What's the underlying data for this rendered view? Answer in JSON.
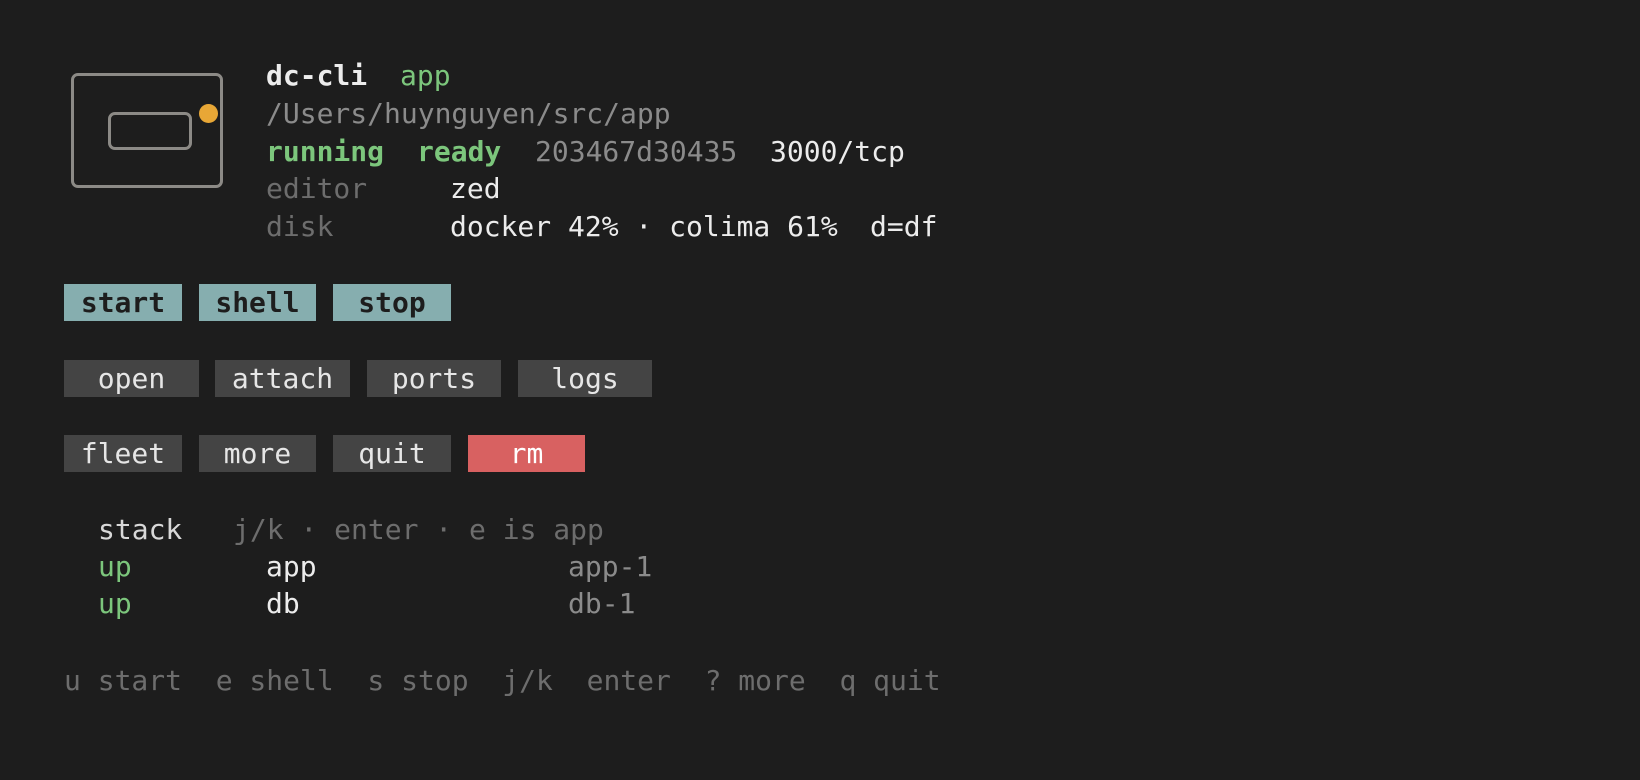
{
  "header": {
    "app_name": "dc-cli",
    "project": "app",
    "path": "/Users/huynguyen/src/app",
    "state": "running",
    "health": "ready",
    "container_id": "203467d30435",
    "ports": "3000/tcp",
    "editor_label": "editor",
    "editor_value": "zed",
    "disk_label": "disk",
    "disk_value": "docker 42% · colima 61%",
    "disk_hint": "d=df"
  },
  "logo": {
    "icon": "container-icon",
    "dot_color": "#e8a736"
  },
  "actions": {
    "row1": [
      {
        "label": "start"
      },
      {
        "label": "shell"
      },
      {
        "label": "stop"
      }
    ],
    "row2": [
      {
        "label": "open"
      },
      {
        "label": "attach"
      },
      {
        "label": "ports"
      },
      {
        "label": "logs"
      }
    ],
    "row3": [
      {
        "label": "fleet"
      },
      {
        "label": "more"
      },
      {
        "label": "quit"
      },
      {
        "label": "rm"
      }
    ]
  },
  "stack": {
    "title": "stack",
    "hint": "j/k · enter · e is app",
    "services": [
      {
        "status": "up",
        "name": "app",
        "container": "app-1"
      },
      {
        "status": "up",
        "name": "db",
        "container": "db-1"
      }
    ]
  },
  "footer": {
    "keys": "u start  e shell  s stop  j/k  enter  ? more  q quit"
  },
  "colors": {
    "background": "#1d1d1d",
    "primary_button": "#86aeaf",
    "secondary_button": "#444444",
    "danger_button": "#d86161",
    "status_green": "#7cc67c"
  }
}
